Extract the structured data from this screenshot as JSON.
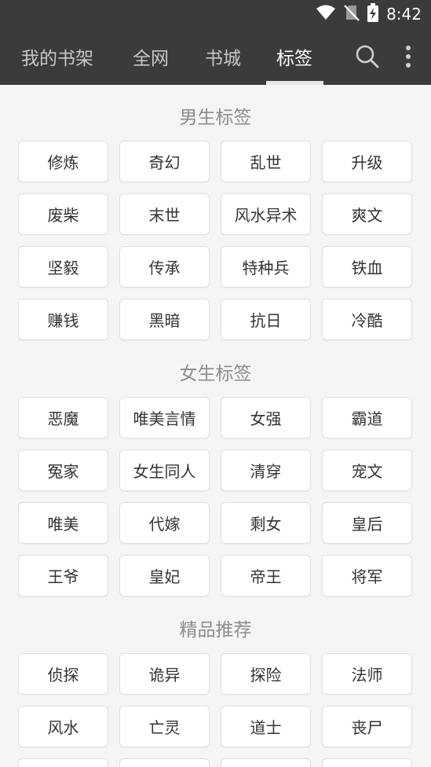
{
  "status_bar": {
    "time": "8:42",
    "icons": [
      "wifi-icon",
      "no-sim-icon",
      "battery-charging-icon"
    ]
  },
  "toolbar": {
    "tabs": [
      {
        "label": "我的书架"
      },
      {
        "label": "全网"
      },
      {
        "label": "书城"
      },
      {
        "label": "标签"
      }
    ],
    "active_tab": "标签",
    "icons": [
      "search-icon",
      "more-vert-icon"
    ]
  },
  "sections": [
    {
      "title": "男生标签",
      "tags": [
        "修炼",
        "奇幻",
        "乱世",
        "升级",
        "废柴",
        "末世",
        "风水异术",
        "爽文",
        "坚毅",
        "传承",
        "特种兵",
        "铁血",
        "赚钱",
        "黑暗",
        "抗日",
        "冷酷"
      ]
    },
    {
      "title": "女生标签",
      "tags": [
        "恶魔",
        "唯美言情",
        "女强",
        "霸道",
        "冤家",
        "女生同人",
        "清穿",
        "宠文",
        "唯美",
        "代嫁",
        "剩女",
        "皇后",
        "王爷",
        "皇妃",
        "帝王",
        "将军"
      ]
    },
    {
      "title": "精品推荐",
      "tags": [
        "侦探",
        "诡异",
        "探险",
        "法师",
        "风水",
        "亡灵",
        "道士",
        "丧尸"
      ]
    }
  ],
  "colors": {
    "toolbar_bg": "#3b3b3b",
    "page_bg": "#f5f5f5",
    "tag_bg": "#ffffff",
    "tag_text": "#333333",
    "section_title": "#8c8c8c"
  }
}
